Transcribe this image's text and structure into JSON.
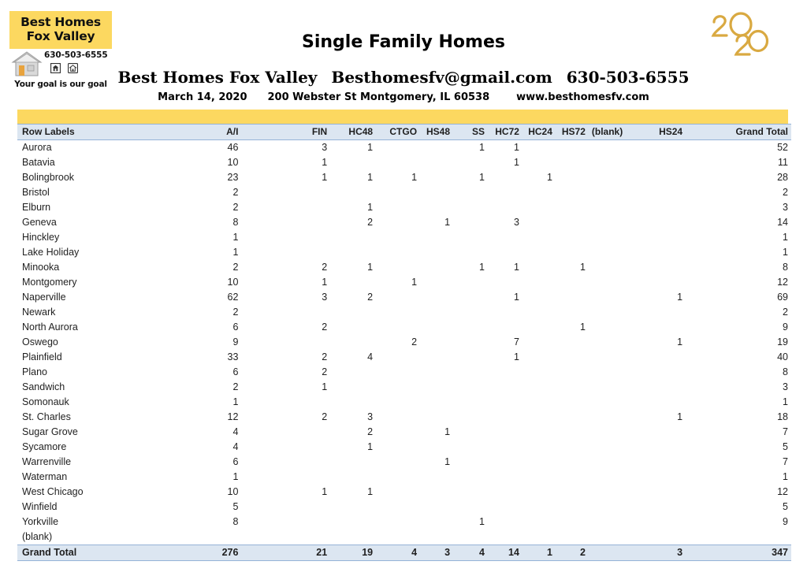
{
  "logo": {
    "line1": "Best Homes",
    "line2": "Fox Valley",
    "phone": "630-503-6555",
    "tagline": "Your goal is our goal",
    "icons": [
      "house-icon",
      "equal-housing-icon",
      "realtor-icon"
    ]
  },
  "header": {
    "title": "Single Family Homes",
    "company": "Best Homes Fox Valley",
    "email": "Besthomesfv@gmail.com",
    "phone": "630-503-6555",
    "date": "March 14, 2020",
    "address": "200 Webster St Montgomery, IL 60538",
    "website": "www.besthomesfv.com",
    "year_badge": "2020"
  },
  "colors": {
    "brand_yellow": "#FCD860",
    "header_blue": "#DCE6F1",
    "border_blue": "#95B3D7",
    "gold": "#D9A941"
  },
  "chart_data": {
    "type": "table",
    "title": "Single Family Homes",
    "columns": [
      "Row Labels",
      "A/I",
      "FIN",
      "HC48",
      "CTGO",
      "HS48",
      "SS",
      "HC72",
      "HC24",
      "HS72",
      "(blank)",
      "HS24",
      "Grand Total"
    ],
    "rows": [
      {
        "label": "Aurora",
        "values": [
          "46",
          "3",
          "1",
          "",
          "",
          "1",
          "1",
          "",
          "",
          "",
          "",
          "52"
        ]
      },
      {
        "label": "Batavia",
        "values": [
          "10",
          "1",
          "",
          "",
          "",
          "",
          "1",
          "",
          "",
          "",
          "",
          "11"
        ]
      },
      {
        "label": "Bolingbrook",
        "values": [
          "23",
          "1",
          "1",
          "1",
          "",
          "1",
          "",
          "1",
          "",
          "",
          "",
          "28"
        ]
      },
      {
        "label": "Bristol",
        "values": [
          "2",
          "",
          "",
          "",
          "",
          "",
          "",
          "",
          "",
          "",
          "",
          "2"
        ]
      },
      {
        "label": "Elburn",
        "values": [
          "2",
          "",
          "1",
          "",
          "",
          "",
          "",
          "",
          "",
          "",
          "",
          "3"
        ]
      },
      {
        "label": "Geneva",
        "values": [
          "8",
          "",
          "2",
          "",
          "1",
          "",
          "3",
          "",
          "",
          "",
          "",
          "14"
        ]
      },
      {
        "label": "Hinckley",
        "values": [
          "1",
          "",
          "",
          "",
          "",
          "",
          "",
          "",
          "",
          "",
          "",
          "1"
        ]
      },
      {
        "label": "Lake Holiday",
        "values": [
          "1",
          "",
          "",
          "",
          "",
          "",
          "",
          "",
          "",
          "",
          "",
          "1"
        ]
      },
      {
        "label": "Minooka",
        "values": [
          "2",
          "2",
          "1",
          "",
          "",
          "1",
          "1",
          "",
          "1",
          "",
          "",
          "8"
        ]
      },
      {
        "label": "Montgomery",
        "values": [
          "10",
          "1",
          "",
          "1",
          "",
          "",
          "",
          "",
          "",
          "",
          "",
          "12"
        ]
      },
      {
        "label": "Naperville",
        "values": [
          "62",
          "3",
          "2",
          "",
          "",
          "",
          "1",
          "",
          "",
          "",
          "1",
          "69"
        ]
      },
      {
        "label": "Newark",
        "values": [
          "2",
          "",
          "",
          "",
          "",
          "",
          "",
          "",
          "",
          "",
          "",
          "2"
        ]
      },
      {
        "label": "North Aurora",
        "values": [
          "6",
          "2",
          "",
          "",
          "",
          "",
          "",
          "",
          "1",
          "",
          "",
          "9"
        ]
      },
      {
        "label": "Oswego",
        "values": [
          "9",
          "",
          "",
          "2",
          "",
          "",
          "7",
          "",
          "",
          "",
          "1",
          "19"
        ]
      },
      {
        "label": "Plainfield",
        "values": [
          "33",
          "2",
          "4",
          "",
          "",
          "",
          "1",
          "",
          "",
          "",
          "",
          "40"
        ]
      },
      {
        "label": "Plano",
        "values": [
          "6",
          "2",
          "",
          "",
          "",
          "",
          "",
          "",
          "",
          "",
          "",
          "8"
        ]
      },
      {
        "label": "Sandwich",
        "values": [
          "2",
          "1",
          "",
          "",
          "",
          "",
          "",
          "",
          "",
          "",
          "",
          "3"
        ]
      },
      {
        "label": "Somonauk",
        "values": [
          "1",
          "",
          "",
          "",
          "",
          "",
          "",
          "",
          "",
          "",
          "",
          "1"
        ]
      },
      {
        "label": "St. Charles",
        "values": [
          "12",
          "2",
          "3",
          "",
          "",
          "",
          "",
          "",
          "",
          "",
          "1",
          "18"
        ]
      },
      {
        "label": "Sugar Grove",
        "values": [
          "4",
          "",
          "2",
          "",
          "1",
          "",
          "",
          "",
          "",
          "",
          "",
          "7"
        ]
      },
      {
        "label": "Sycamore",
        "values": [
          "4",
          "",
          "1",
          "",
          "",
          "",
          "",
          "",
          "",
          "",
          "",
          "5"
        ]
      },
      {
        "label": "Warrenville",
        "values": [
          "6",
          "",
          "",
          "",
          "1",
          "",
          "",
          "",
          "",
          "",
          "",
          "7"
        ]
      },
      {
        "label": "Waterman",
        "values": [
          "1",
          "",
          "",
          "",
          "",
          "",
          "",
          "",
          "",
          "",
          "",
          "1"
        ]
      },
      {
        "label": "West Chicago",
        "values": [
          "10",
          "1",
          "1",
          "",
          "",
          "",
          "",
          "",
          "",
          "",
          "",
          "12"
        ]
      },
      {
        "label": "Winfield",
        "values": [
          "5",
          "",
          "",
          "",
          "",
          "",
          "",
          "",
          "",
          "",
          "",
          "5"
        ]
      },
      {
        "label": "Yorkville",
        "values": [
          "8",
          "",
          "",
          "",
          "",
          "1",
          "",
          "",
          "",
          "",
          "",
          "9"
        ]
      },
      {
        "label": "(blank)",
        "values": [
          "",
          "",
          "",
          "",
          "",
          "",
          "",
          "",
          "",
          "",
          "",
          ""
        ]
      }
    ],
    "total_row": {
      "label": "Grand Total",
      "values": [
        "276",
        "21",
        "19",
        "4",
        "3",
        "4",
        "14",
        "1",
        "2",
        "",
        "3",
        "347"
      ]
    }
  }
}
